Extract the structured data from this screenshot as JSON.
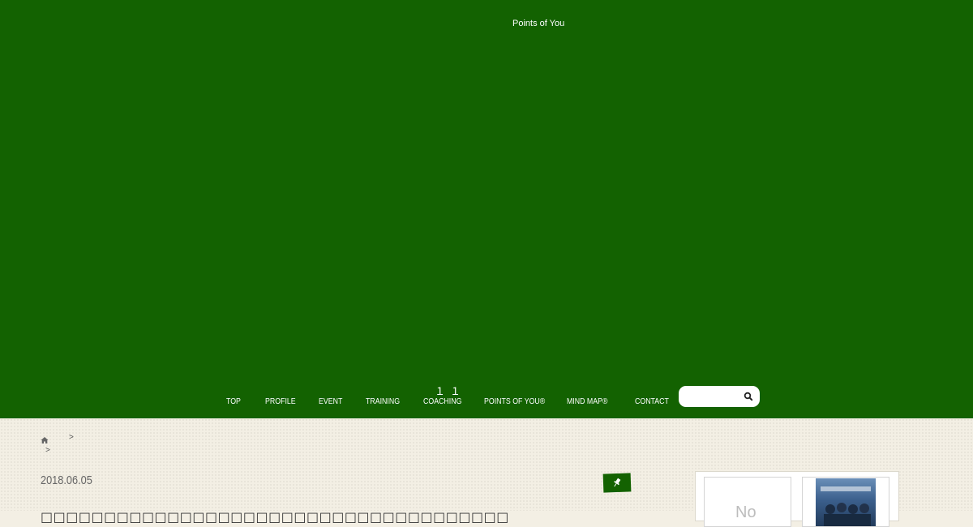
{
  "header": {
    "site_title": "Points of You",
    "background_color": "#136201"
  },
  "nav": {
    "superscript": "１１",
    "items": [
      {
        "label": "TOP"
      },
      {
        "label": "PROFILE"
      },
      {
        "label": "EVENT"
      },
      {
        "label": "TRAINING"
      },
      {
        "label": "COACHING"
      },
      {
        "label": "POINTS OF YOU®"
      },
      {
        "label": "MIND MAP®"
      },
      {
        "label": "CONTACT"
      }
    ]
  },
  "search": {
    "placeholder": "",
    "value": "",
    "icon": "search-icon"
  },
  "breadcrumb": {
    "home_icon": "home-icon",
    "separator": ">"
  },
  "post": {
    "date": "2018.06.05",
    "pin_icon": "pin-icon",
    "title": "□□□□□□□□□□□□□□□□□□□□□□□□□□□□□□□□□□□□□"
  },
  "sidebar": {
    "noimage_text": "No",
    "photo_icon": "movie-poster-thumbnail"
  }
}
